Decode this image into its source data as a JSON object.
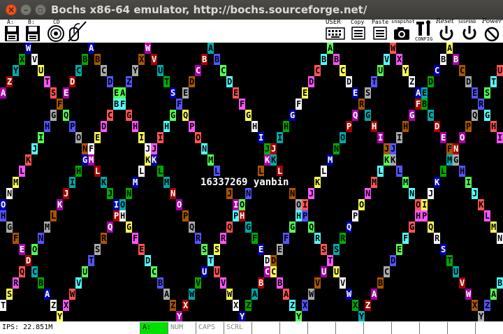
{
  "window": {
    "title": "Bochs x86-64 emulator, http://bochs.sourceforge.net/"
  },
  "toolbar": {
    "drive_a": "A:",
    "drive_b": "B:",
    "cdrom": "CD",
    "user": "USER",
    "copy": "Copy",
    "paste": "Paste",
    "snapshot": "snapshot",
    "config": "CONFIG",
    "reset": "Reset",
    "suspend": "SUSPEND",
    "power": "Power"
  },
  "screen": {
    "message": "16337269 yanbin",
    "palette": [
      "#0000aa",
      "#00aa00",
      "#00aaaa",
      "#aa0000",
      "#aa00aa",
      "#aa5500",
      "#aaaaaa",
      "#5555ff",
      "#55ff55",
      "#55ffff",
      "#ff5555",
      "#ff55ff",
      "#ffff55",
      "#ffffff"
    ],
    "waves": [
      {
        "label": "ABCDEFGHIJKLMNOPQRSTUVWXYZ",
        "start": 14,
        "dir": -1,
        "shift": 0
      },
      {
        "label": "ABCDEFGHIJKLMNOPQRSTUVWXYZ",
        "start": 33,
        "dir": -1,
        "shift": 2
      },
      {
        "label": "ABCDEFGHIJKLMNOPQRSTUVWXYZ",
        "start": 14,
        "dir": 1,
        "shift": 4
      },
      {
        "label": "ABCDEFGHIJKLMNOPQRSTUVWXYZ",
        "start": 33,
        "dir": 1,
        "shift": 6
      },
      {
        "label": "ABCDEFGHIJKLMNOPQRSTUVWXYZ",
        "start": 52,
        "dir": -1,
        "shift": 8
      },
      {
        "label": "ABCDEFGHIJKLMNOPQRSTUVWXYZ",
        "start": 52,
        "dir": 1,
        "shift": 10
      },
      {
        "label": "ABCDEFGHIJKLMNOPQRSTUVWXYZ",
        "start": 71,
        "dir": -1,
        "shift": 12
      },
      {
        "label": "ABCDEFGHIJKLMNOPQRSTUVWXYZ",
        "start": 71,
        "dir": 1,
        "shift": 3
      }
    ]
  },
  "status": {
    "ips": "IPS: 22.851M",
    "drive_a": "A:",
    "num": "NUM",
    "caps": "CAPS",
    "scrl": "SCRL"
  }
}
